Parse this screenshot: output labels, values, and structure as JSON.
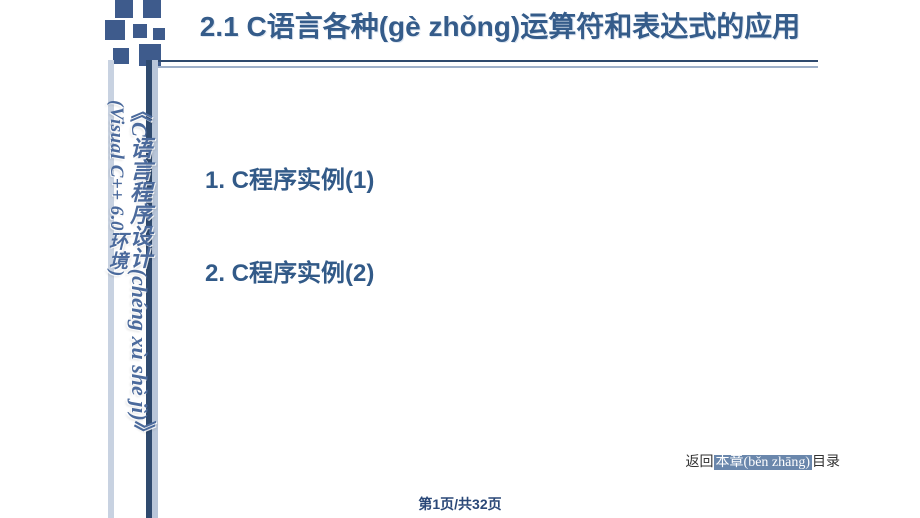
{
  "sidebar": {
    "book_title_vertical": "《C语言程序设计(chéng xù shè jì)》",
    "env_vertical": "(Visual C++ 6.0环境)"
  },
  "title": "2.1   C语言各种(gè zhǒng)运算符和表达式的应用",
  "items": [
    {
      "label": "1. C程序实例(1)"
    },
    {
      "label": "2. C程序实例(2)"
    }
  ],
  "footer_link": {
    "prefix": "返回",
    "highlight": "本章(běn zhāng)",
    "suffix": "目录"
  },
  "page_indicator": "第1页/共32页"
}
